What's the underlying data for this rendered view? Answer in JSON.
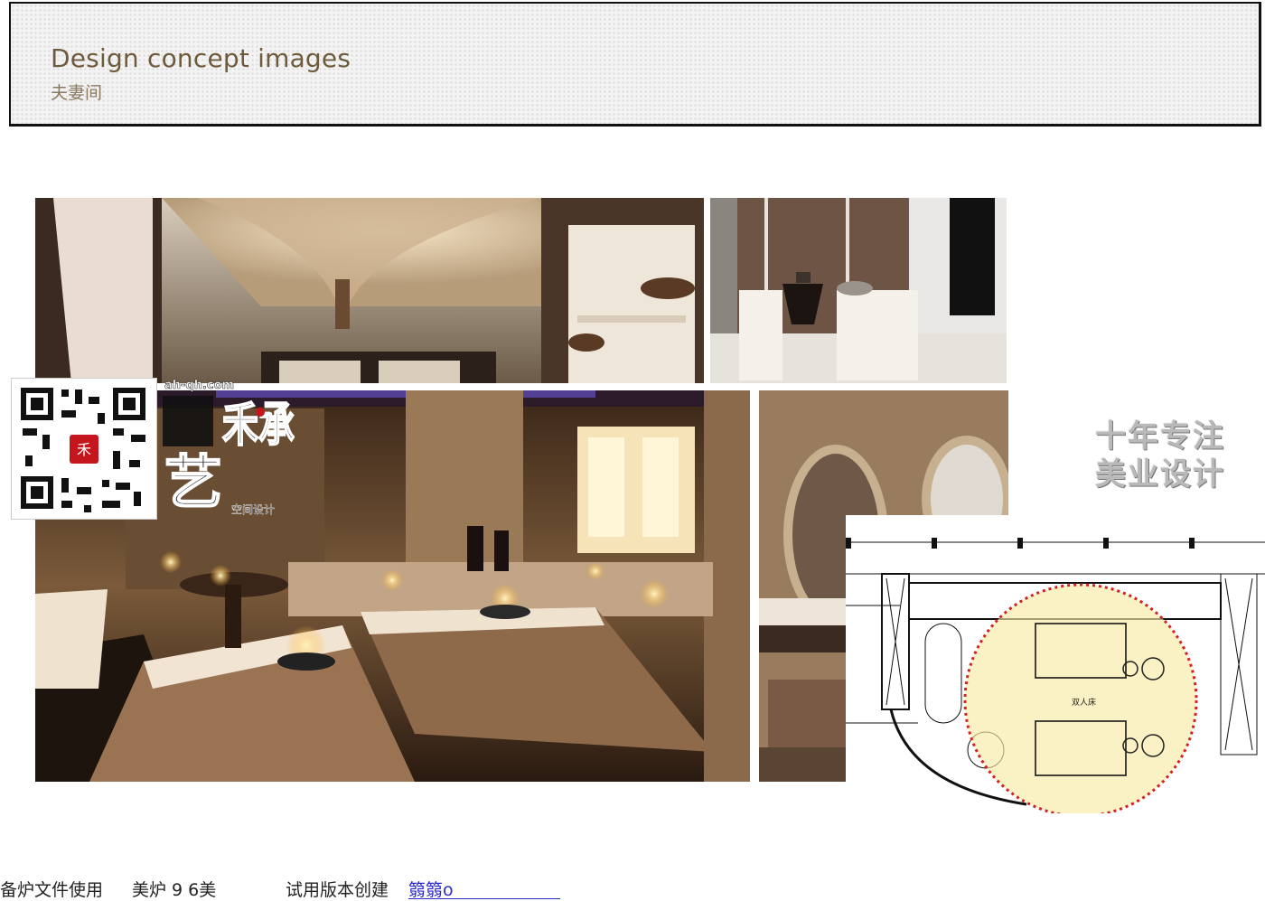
{
  "header": {
    "title": "Design concept images",
    "subtitle": "夫妻间"
  },
  "logo": {
    "domain": "ah-qh.com",
    "brand_chars": "禾承",
    "brand_left": "艺",
    "tagline": "空间设计"
  },
  "slogan": {
    "line1": "十年专注",
    "line2": "美业设计"
  },
  "floorplan": {
    "room_label": "双人床"
  },
  "footer": {
    "text1": "备炉文件使用",
    "text2": "美炉 9 6美",
    "text3": "试用版本创建",
    "link": "篛篛o"
  },
  "colors": {
    "title": "#6e5a3c",
    "highlight_circle": "#f7eaa6",
    "dotted_red": "#d42020",
    "link": "#2a2ad0"
  }
}
